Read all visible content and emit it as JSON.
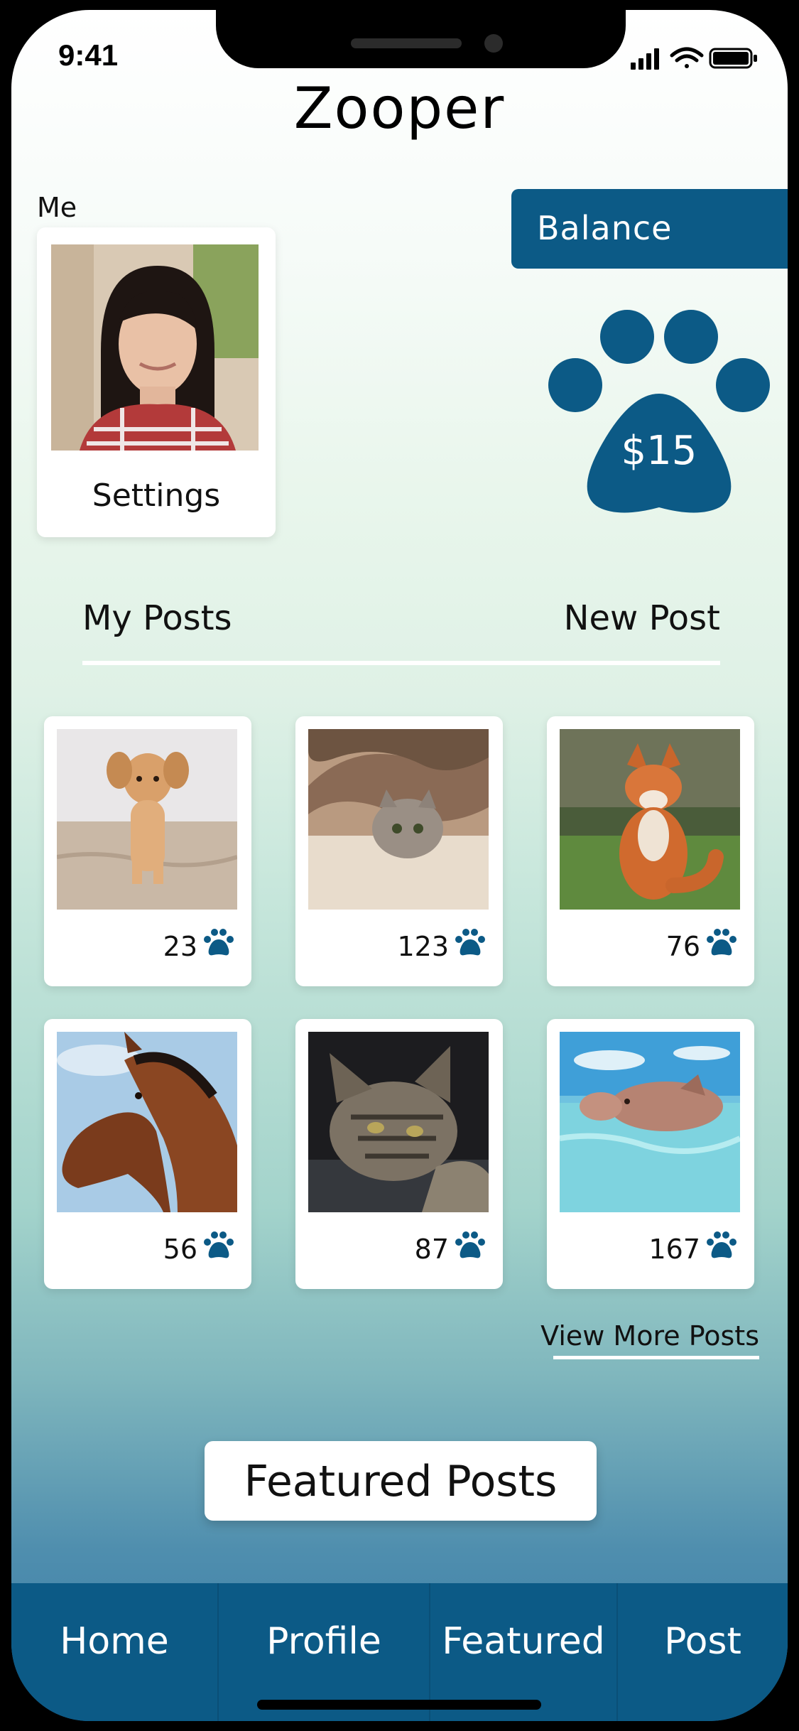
{
  "status_bar": {
    "time": "9:41",
    "icons": [
      "signal-icon",
      "wifi-icon",
      "battery-icon"
    ]
  },
  "app": {
    "title": "Zooper"
  },
  "profile": {
    "section_label": "Me",
    "settings_label": "Settings",
    "photo": "profile-photo-woman"
  },
  "balance": {
    "label": "Balance",
    "value": "$15",
    "icon": "paw-icon"
  },
  "post_tabs": {
    "my_posts": "My Posts",
    "new_post": "New Post"
  },
  "posts": [
    {
      "image": "dog-photo",
      "count": "23"
    },
    {
      "image": "cat-under-blanket-photo",
      "count": "123"
    },
    {
      "image": "fox-photo",
      "count": "76"
    },
    {
      "image": "horse-photo",
      "count": "56"
    },
    {
      "image": "tabby-cat-photo",
      "count": "87"
    },
    {
      "image": "swimming-pig-photo",
      "count": "167"
    }
  ],
  "view_more_label": "View More Posts",
  "featured_button_label": "Featured Posts",
  "bottom_nav": [
    {
      "label": "Home"
    },
    {
      "label": "Profile"
    },
    {
      "label": "Featured"
    },
    {
      "label": "Post"
    }
  ],
  "colors": {
    "primary": "#0c5a86",
    "background_top": "#ffffff",
    "background_bottom": "#3a7ca6"
  }
}
